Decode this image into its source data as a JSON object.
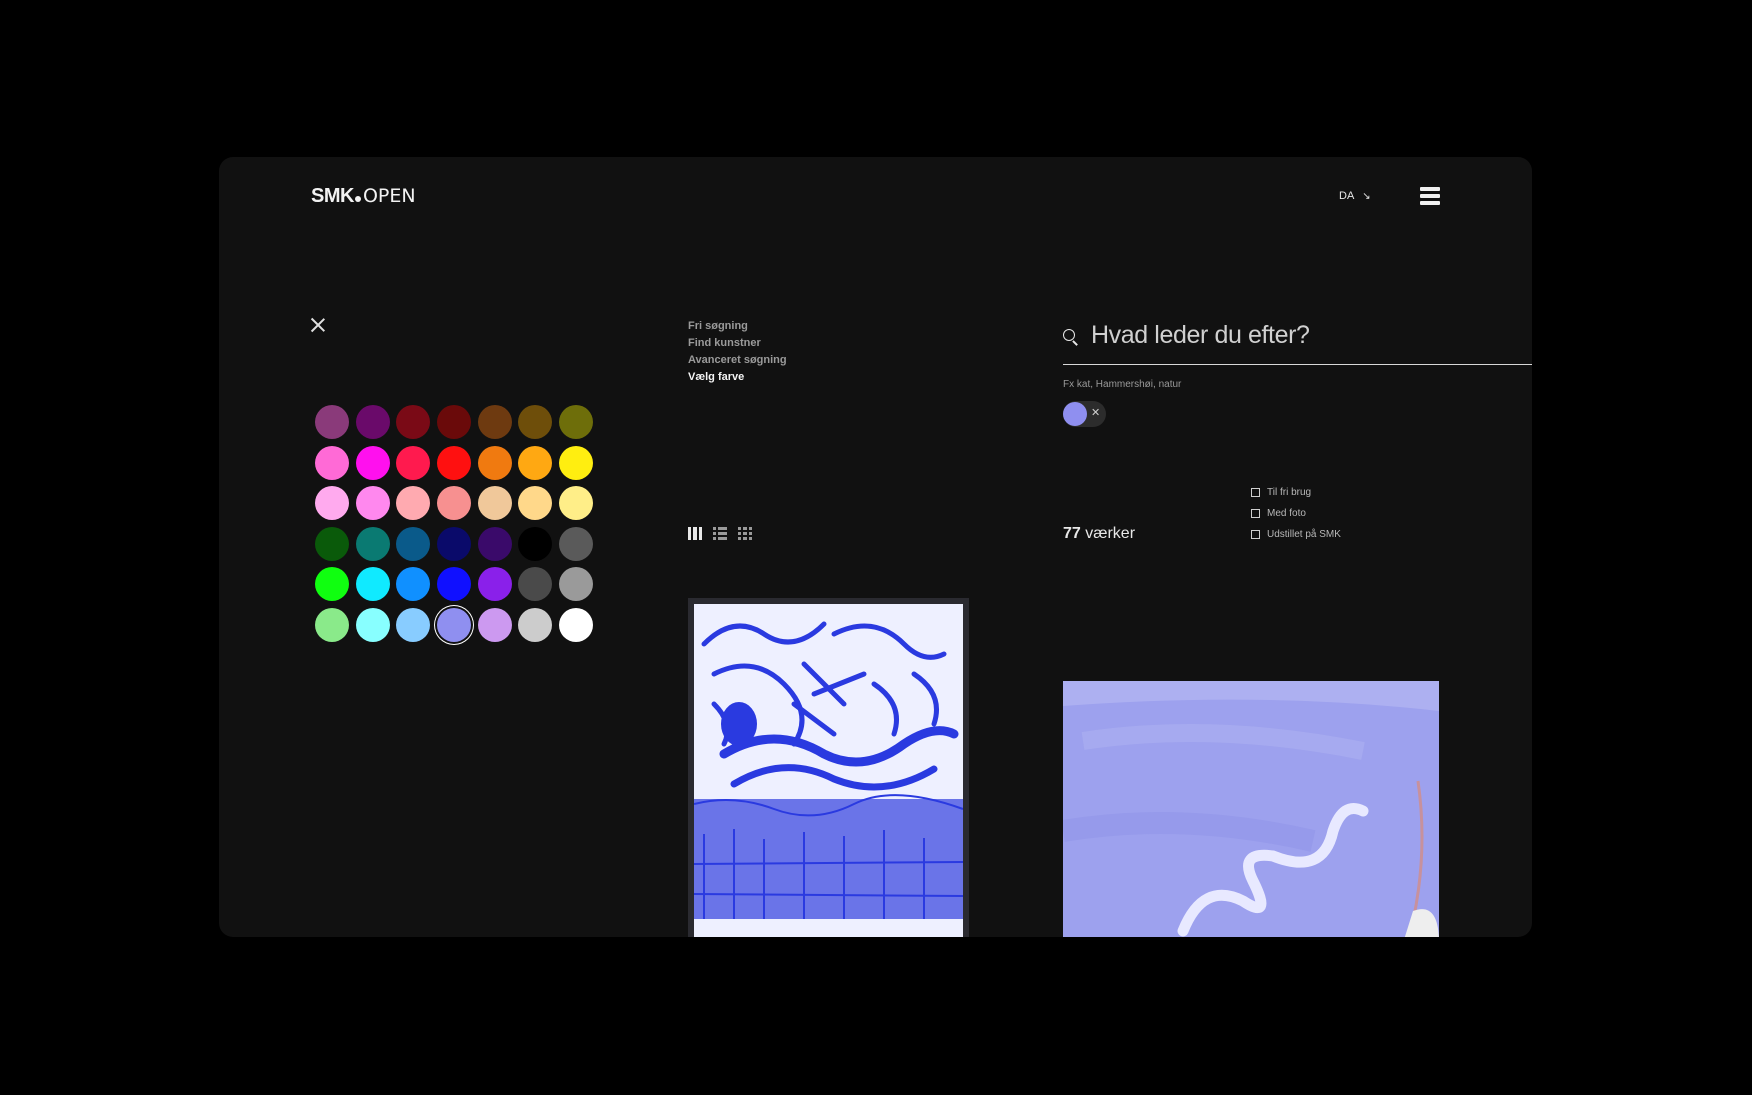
{
  "header": {
    "logo_bold": "SMK",
    "logo_light": "OPEN",
    "language": "DA",
    "language_arrow": "↘"
  },
  "search_nav": {
    "items": [
      {
        "label": "Fri søgning",
        "active": false
      },
      {
        "label": "Find kunstner",
        "active": false
      },
      {
        "label": "Avanceret søgning",
        "active": false
      },
      {
        "label": "Vælg farve",
        "active": true
      }
    ]
  },
  "search": {
    "placeholder": "Hvad leder du efter?",
    "hint": "Fx kat, Hammershøi, natur"
  },
  "selected_color": {
    "color": "#8f8ff0",
    "remove_label": "✕"
  },
  "palette": {
    "rows": [
      [
        "#8a3a7a",
        "#6a0a6a",
        "#7a0a16",
        "#6a0a0a",
        "#6e3a10",
        "#6e4e0a",
        "#6e6e0a"
      ],
      [
        "#ff6ad6",
        "#ff10ee",
        "#ff1a4e",
        "#ff1010",
        "#f07a10",
        "#ffa812",
        "#ffee10"
      ],
      [
        "#ffaaee",
        "#ff88ee",
        "#ffaab0",
        "#f79090",
        "#f0c89a",
        "#ffd88a",
        "#ffee88"
      ],
      [
        "#0a5a0a",
        "#0a7a72",
        "#0a5a8a",
        "#0a0a6a",
        "#3a0a6a",
        "#000000",
        "#5a5a5a"
      ],
      [
        "#10ff10",
        "#10eaff",
        "#1090ff",
        "#1010ff",
        "#8a20ea",
        "#4a4a4a",
        "#9a9a9a"
      ],
      [
        "#8aea8a",
        "#88ffff",
        "#88ccff",
        "#8f8ff0",
        "#cc99f0",
        "#cccccc",
        "#ffffff"
      ]
    ],
    "selected": "#8f8ff0"
  },
  "results": {
    "count": "77",
    "count_label": "værker"
  },
  "filters": [
    {
      "label": "Til fri brug"
    },
    {
      "label": "Med foto"
    },
    {
      "label": "Udstillet på SMK"
    }
  ],
  "icons": {
    "close": "close-icon",
    "menu": "hamburger-menu-icon",
    "search": "search-icon",
    "views": [
      "columns-view-icon",
      "list-view-icon",
      "grid-view-icon"
    ]
  }
}
